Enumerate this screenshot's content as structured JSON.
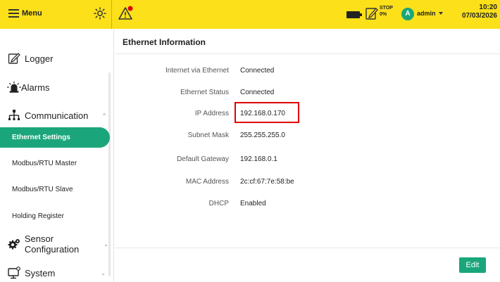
{
  "topbar": {
    "menu_label": "Menu",
    "stop_label": "STOP",
    "stop_percent": "0%",
    "avatar_letter": "A",
    "user_name": "admin",
    "time": "10:20",
    "date": "07/03/2026",
    "icons": [
      "menu-icon",
      "brightness-icon",
      "alarm-warning-icon",
      "battery-icon",
      "stop-status-icon"
    ]
  },
  "sidebar": {
    "items": [
      {
        "label": "Logger",
        "icon": "edit-icon"
      },
      {
        "label": "Alarms",
        "icon": "siren-icon"
      },
      {
        "label": "Communication",
        "icon": "network-icon"
      },
      {
        "label": "Sensor Configuration",
        "icon": "gear-icon"
      },
      {
        "label": "System",
        "icon": "computer-icon"
      }
    ],
    "sub_items": [
      {
        "label": "Ethernet Settings",
        "active": true
      },
      {
        "label": "Modbus/RTU Master",
        "active": false
      },
      {
        "label": "Modbus/RTU Slave",
        "active": false
      },
      {
        "label": "Holding Register",
        "active": false
      }
    ]
  },
  "main": {
    "title": "Ethernet Information",
    "rows": [
      {
        "label": "Internet via Ethernet",
        "value": "Connected"
      },
      {
        "label": "Ethernet Status",
        "value": "Connected"
      },
      {
        "label": "IP Address",
        "value": "192.168.0.170"
      },
      {
        "label": "Subnet Mask",
        "value": "255.255.255.0"
      },
      {
        "label": "Default Gateway",
        "value": "192.168.0.1"
      },
      {
        "label": "MAC Address",
        "value": "2c:cf:67:7e:58:be"
      },
      {
        "label": "DHCP",
        "value": "Enabled"
      }
    ],
    "edit_label": "Edit"
  },
  "colors": {
    "topbar": "#fbe01a",
    "accent": "#1aa67a",
    "highlight": "#e00000",
    "warning_dot": "#e00000"
  }
}
